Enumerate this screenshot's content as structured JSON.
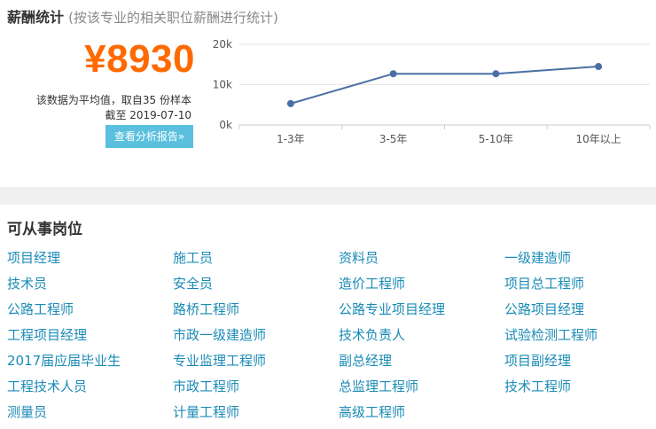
{
  "salary": {
    "title": "薪酬统计",
    "subtitle": "(按该专业的相关职位薪酬进行统计)",
    "amount": "¥8930",
    "note_line1": "该数据为平均值，取自35 份样本",
    "note_line2": "截至 2019-07-10",
    "report_button": "查看分析报告»"
  },
  "chart_data": {
    "type": "line",
    "categories": [
      "1-3年",
      "3-5年",
      "5-10年",
      "10年以上"
    ],
    "values": [
      5300,
      12700,
      12700,
      14500
    ],
    "y_ticks": [
      "0k",
      "10k",
      "20k"
    ],
    "ylim": [
      0,
      20000
    ],
    "color": "#4a6fa5",
    "grid": "horizontal"
  },
  "jobs": {
    "title": "可从事岗位",
    "items": [
      "项目经理",
      "施工员",
      "资料员",
      "一级建造师",
      "技术员",
      "安全员",
      "造价工程师",
      "项目总工程师",
      "公路工程师",
      "路桥工程师",
      "公路专业项目经理",
      "公路项目经理",
      "工程项目经理",
      "市政一级建造师",
      "技术负责人",
      "试验检测工程师",
      "2017届应届毕业生",
      "专业监理工程师",
      "副总经理",
      "项目副经理",
      "工程技术人员",
      "市政工程师",
      "总监理工程师",
      "技术工程师",
      "测量员",
      "计量工程师",
      "高级工程师"
    ]
  }
}
